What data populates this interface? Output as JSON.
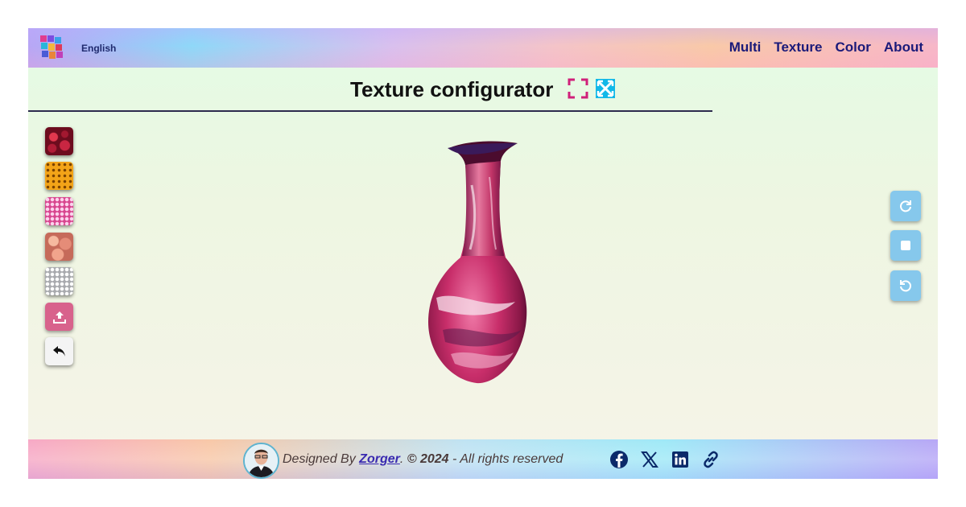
{
  "header": {
    "language": "English",
    "nav": [
      "Multi",
      "Texture",
      "Color",
      "About"
    ]
  },
  "title": "Texture configurator",
  "textures": [
    "red-roses",
    "yellow-flowers",
    "pink-pattern",
    "peach-roses",
    "white-pebbles"
  ],
  "footer": {
    "designed_by": "Designed By",
    "author": "Zorger",
    "dot": ".",
    "year": "© 2024",
    "rights": "- All rights reserved"
  },
  "colors": {
    "nav_text": "#1a1a7a",
    "upload_button": "#d8628c",
    "control_button": "#86c8ec",
    "fullscreen_pink": "#d0207a",
    "fullscreen_cyan": "#12b8e8"
  },
  "icons": {
    "logo": "app-logo-icon",
    "fullscreen": "fullscreen-icon",
    "expand": "expand-icon",
    "upload": "upload-icon",
    "back": "undo-arrow-icon",
    "rotate_right": "rotate-right-icon",
    "stop": "stop-icon",
    "rotate_left": "rotate-left-icon",
    "facebook": "facebook-icon",
    "x": "x-icon",
    "linkedin": "linkedin-icon",
    "link": "link-icon"
  }
}
